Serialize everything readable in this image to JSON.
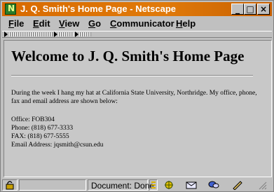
{
  "window": {
    "title": "J. Q. Smith's Home Page - Netscape",
    "controls": [
      "_",
      "□",
      "×"
    ]
  },
  "menu": {
    "items": [
      "File",
      "Edit",
      "View",
      "Go",
      "Communicator",
      "Help"
    ],
    "mnemonics": [
      "F",
      "E",
      "V",
      "G",
      "C",
      "H"
    ]
  },
  "page": {
    "heading": "Welcome to  J. Q. Smith's Home Page",
    "paragraph": "During the week I hang my hat at California State University, Northridge.  My office, phone, fax and email address are shown below:",
    "contact": [
      "Office: FOB304",
      "Phone: (818) 677-3333",
      "FAX: (818) 677-5555",
      "Email Address: jqsmith@csun.edu"
    ]
  },
  "status": {
    "text": "Document: Done",
    "icons": [
      "security-lock-icon",
      "progress-icon",
      "navigator-icon",
      "mail-icon",
      "discussion-icon",
      "composer-icon"
    ]
  },
  "colors": {
    "titlebar": "#d86a00",
    "chrome": "#c0c0c0",
    "content_bg": "#c8c8c8"
  }
}
